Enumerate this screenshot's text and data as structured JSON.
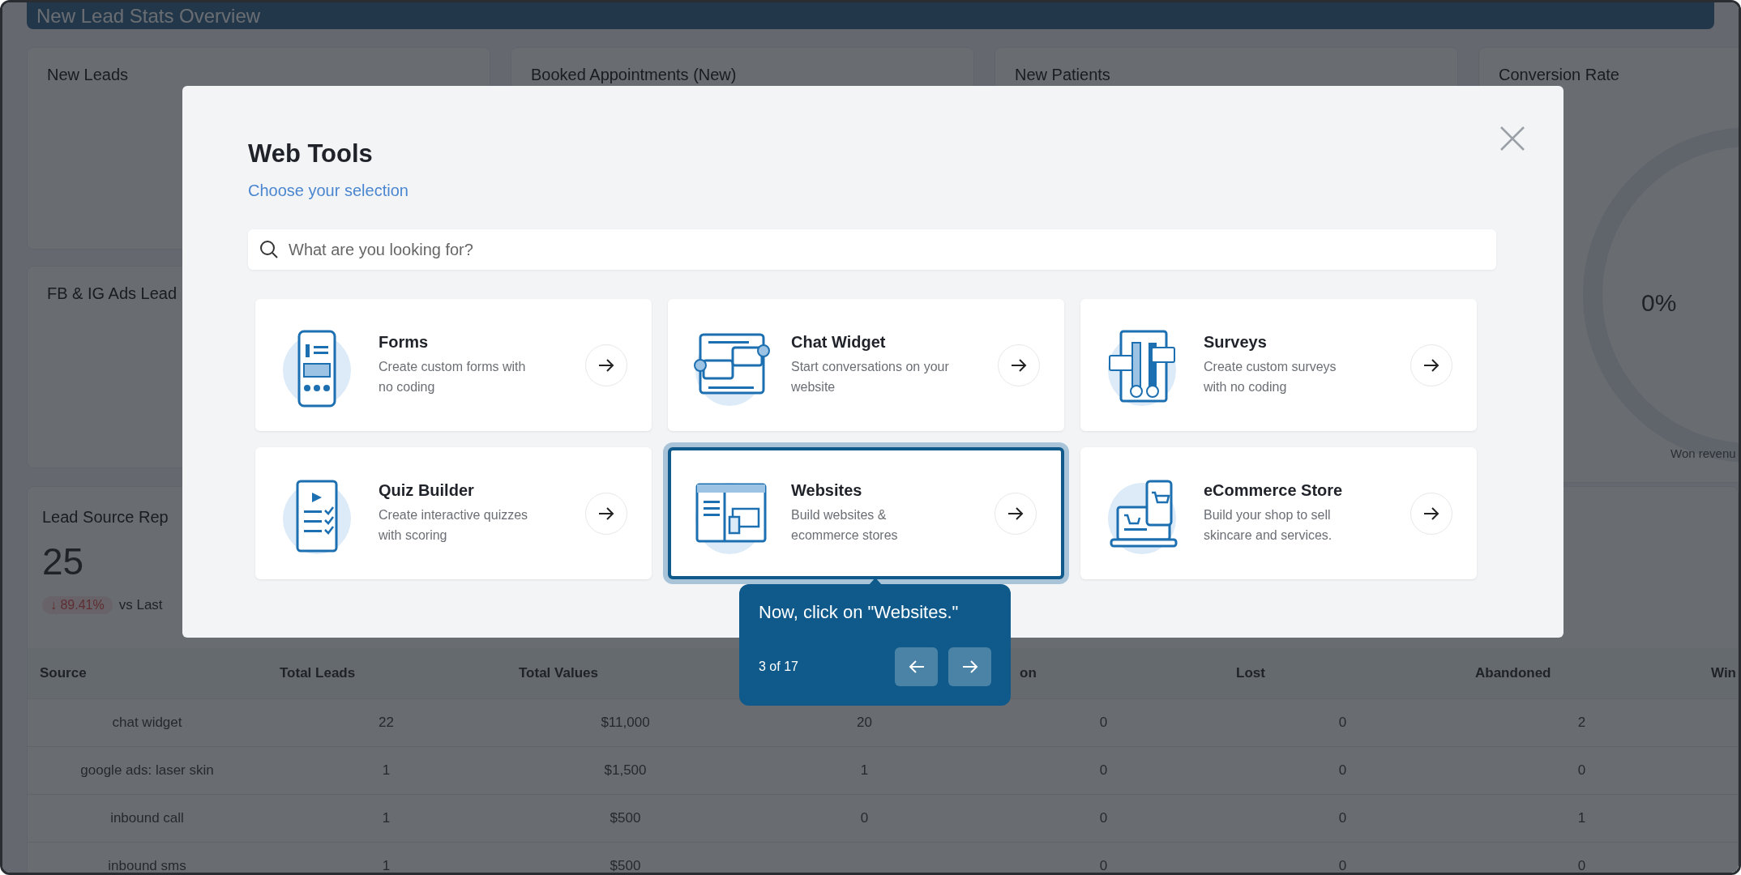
{
  "dashboard": {
    "header": {
      "title": "New Lead Stats Overview"
    },
    "stat_cards": [
      {
        "title": "New Leads"
      },
      {
        "title": "Booked Appointments (New)"
      },
      {
        "title": "New Patients"
      }
    ],
    "side_card": {
      "title": "FB & IG Ads Lead"
    },
    "conversion_card": {
      "title": "Conversion Rate",
      "value": "0%",
      "caption": "Won revenu"
    },
    "lead_source": {
      "title": "Lead Source Rep",
      "total": "25",
      "change": "↓ 89.41%",
      "comparison": "vs Last",
      "table": {
        "columns": [
          "Source",
          "Total Leads",
          "Total Values",
          null,
          "on",
          "Lost",
          "Abandoned",
          "Win"
        ],
        "rows": [
          [
            "chat widget",
            "22",
            "$11,000",
            "20",
            "0",
            "0",
            "2"
          ],
          [
            "google ads: laser skin",
            "1",
            "$1,500",
            "1",
            "0",
            "0",
            "0"
          ],
          [
            "inbound call",
            "1",
            "$500",
            "0",
            "0",
            "0",
            "1"
          ],
          [
            "inbound sms",
            "1",
            "$500",
            null,
            "0",
            "0",
            "0"
          ]
        ]
      }
    }
  },
  "modal": {
    "title": "Web Tools",
    "subtitle": "Choose your selection",
    "search": {
      "placeholder": "What are you looking for?"
    },
    "tools": [
      {
        "kind": "form",
        "title": "Forms",
        "description": "Create custom forms with no coding",
        "selected": false
      },
      {
        "kind": "chat",
        "title": "Chat Widget",
        "description": "Start conversations on your website",
        "selected": false
      },
      {
        "kind": "survey",
        "title": "Surveys",
        "description": "Create custom surveys with no coding",
        "selected": false
      },
      {
        "kind": "quiz",
        "title": "Quiz Builder",
        "description": "Create interactive quizzes with scoring",
        "selected": false
      },
      {
        "kind": "website",
        "title": "Websites",
        "description": "Build websites & ecommerce stores",
        "selected": true
      },
      {
        "kind": "store",
        "title": "eCommerce Store",
        "description": "Build your shop to sell skincare and services.",
        "selected": false
      }
    ]
  },
  "tour_tooltip": {
    "message": "Now, click on \"Websites.\"",
    "step": "3 of 17"
  }
}
